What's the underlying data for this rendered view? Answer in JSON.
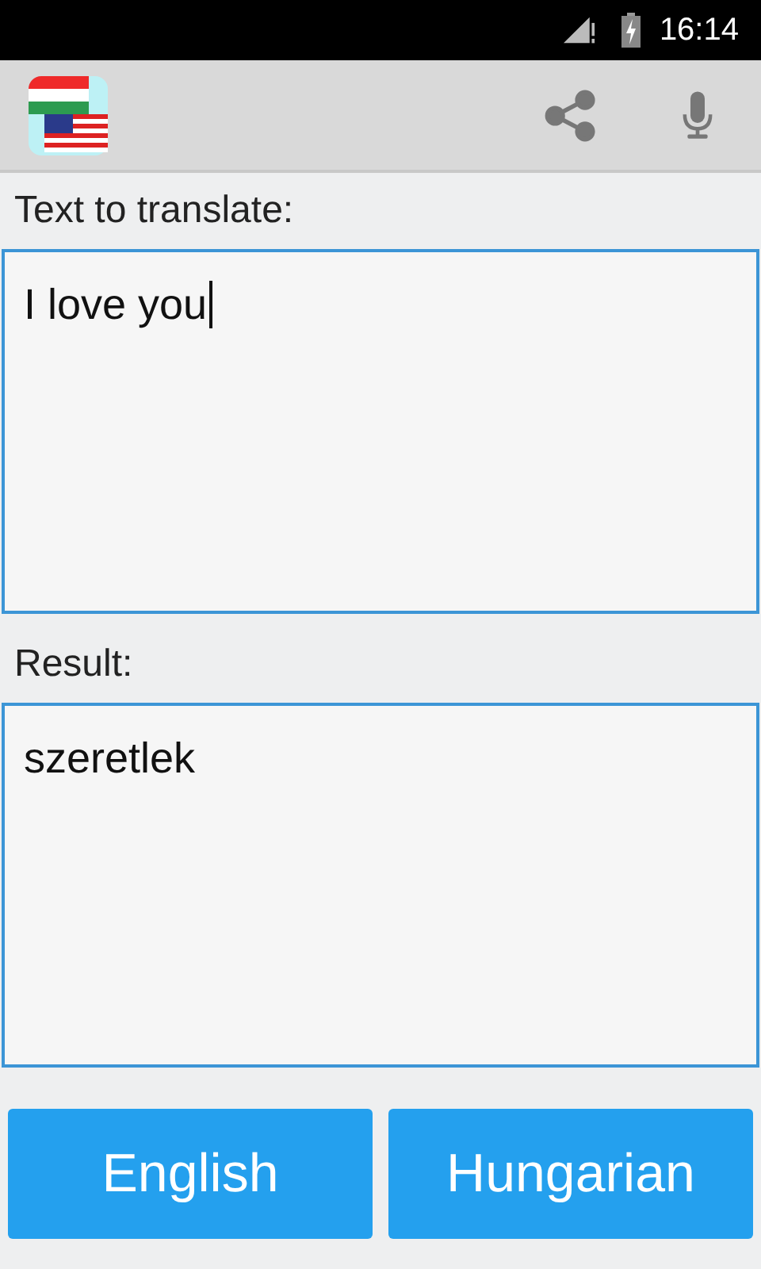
{
  "status_bar": {
    "time": "16:14"
  },
  "toolbar": {
    "actions": [
      {
        "kind": "share"
      },
      {
        "kind": "microphone"
      }
    ]
  },
  "input": {
    "label": "Text to translate:",
    "value": "I love you",
    "focused": true
  },
  "result": {
    "label": "Result:",
    "value": "szeretlek"
  },
  "buttons": [
    {
      "label": "English"
    },
    {
      "label": "Hungarian"
    }
  ]
}
